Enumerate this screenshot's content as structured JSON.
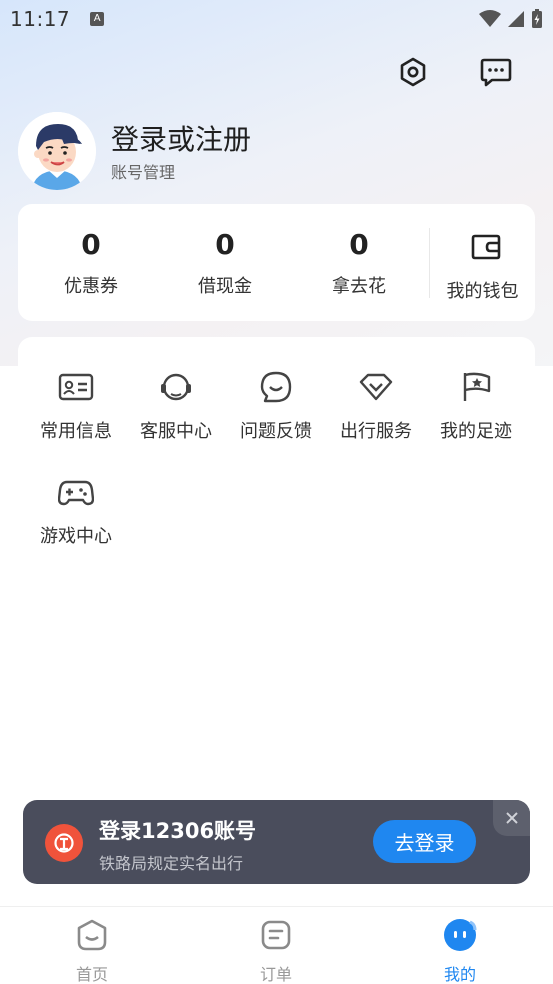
{
  "status_bar": {
    "time": "11:17",
    "notification_badge": "A"
  },
  "header": {
    "settings_icon": "settings-hexagon-icon",
    "messages_icon": "chat-bubble-icon"
  },
  "profile": {
    "title": "登录或注册",
    "subtitle": "账号管理"
  },
  "stats": [
    {
      "value": "0",
      "label": "优惠券"
    },
    {
      "value": "0",
      "label": "借现金"
    },
    {
      "value": "0",
      "label": "拿去花"
    }
  ],
  "wallet": {
    "label": "我的钱包",
    "icon": "wallet-icon"
  },
  "services": [
    {
      "label": "常用信息",
      "icon": "id-card-icon"
    },
    {
      "label": "客服中心",
      "icon": "headset-icon"
    },
    {
      "label": "问题反馈",
      "icon": "feedback-icon"
    },
    {
      "label": "出行服务",
      "icon": "diamond-icon"
    },
    {
      "label": "我的足迹",
      "icon": "flag-icon"
    },
    {
      "label": "游戏中心",
      "icon": "gamepad-icon"
    }
  ],
  "login_banner": {
    "title": "登录12306账号",
    "subtitle": "铁路局规定实名出行",
    "button": "去登录",
    "accent": "#1f87f0",
    "logo_color": "#f0533b"
  },
  "bottom_nav": [
    {
      "label": "首页",
      "active": false
    },
    {
      "label": "订单",
      "active": false
    },
    {
      "label": "我的",
      "active": true
    }
  ]
}
